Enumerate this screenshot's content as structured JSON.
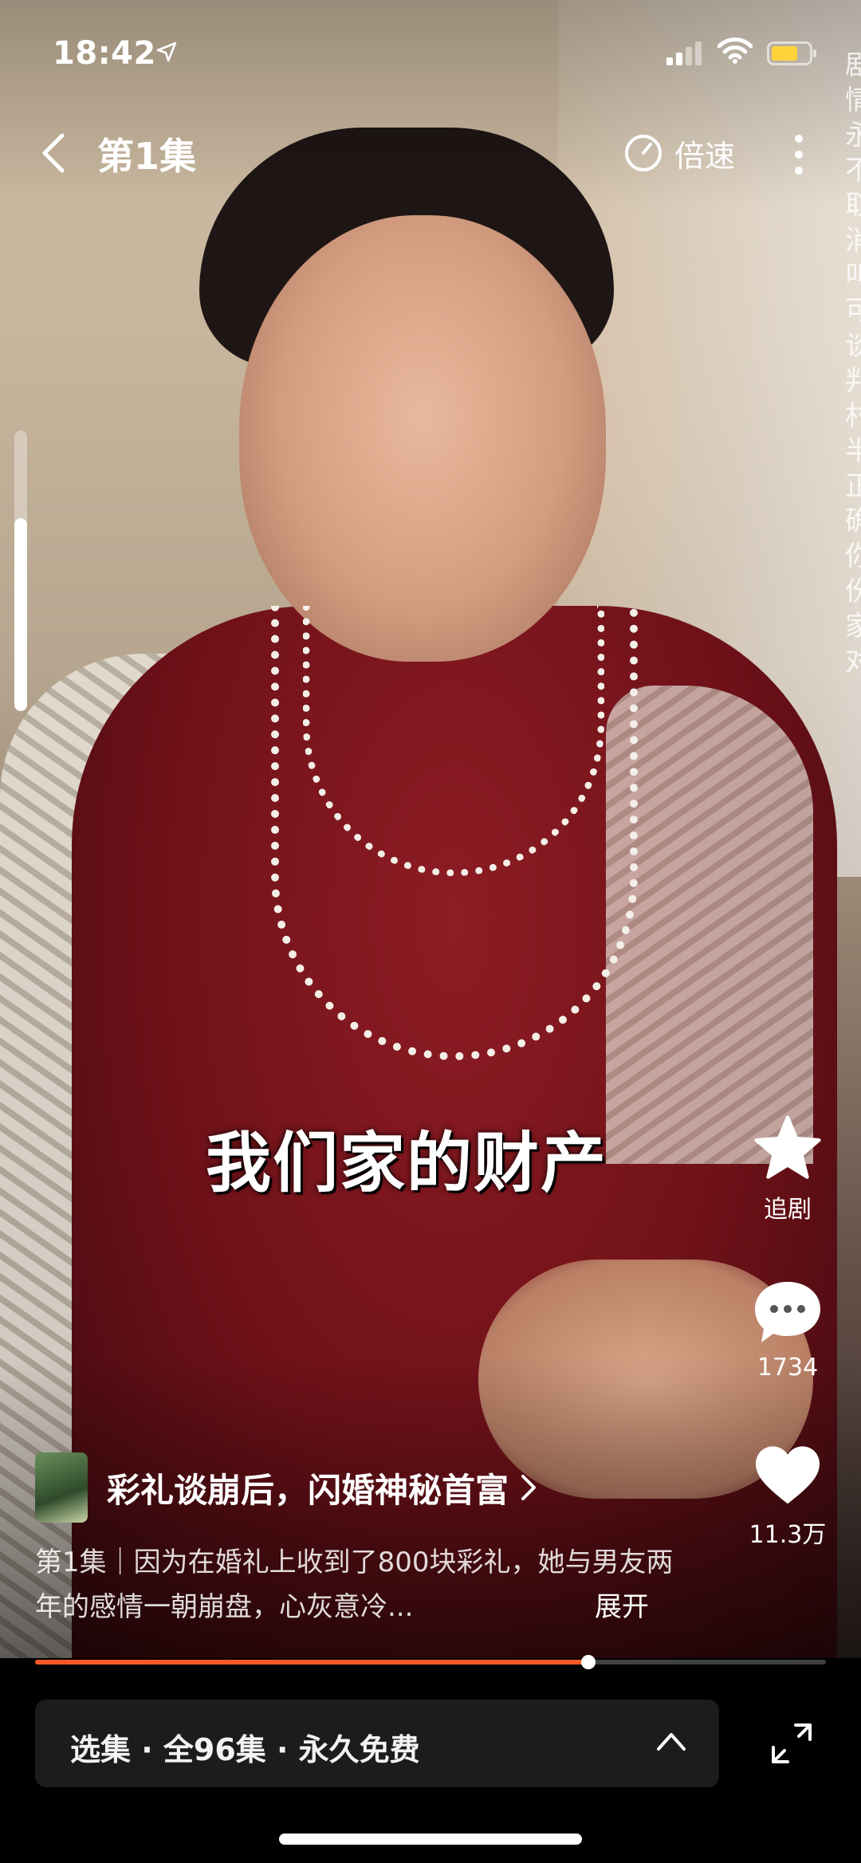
{
  "status_bar": {
    "time": "18:42",
    "icons": [
      "location-arrow-icon",
      "signal-icon",
      "wifi-icon",
      "battery-icon"
    ]
  },
  "nav": {
    "episode_title": "第1集",
    "speed_label": "倍速",
    "icons": [
      "back-icon",
      "speed-icon",
      "more-icon"
    ]
  },
  "edge_text": "剧情永不取消叫可谈判村半正确你份家对",
  "subtitle": "我们家的财产",
  "actions": {
    "follow_label": "追剧",
    "comment_count": "1734",
    "like_count": "11.3万"
  },
  "drama": {
    "title": "彩礼谈崩后，闪婚神秘首富",
    "description": "第1集｜因为在婚礼上收到了800块彩礼，她与男友两年的感情一朝崩盘，心灰意冷...",
    "expand_label": "展开"
  },
  "playback": {
    "progress": 0.7
  },
  "bottom": {
    "episode_selector_label": "选集 · 全96集 · 永久免费"
  },
  "colors": {
    "accent": "#ff5a26",
    "selector_bg": "#1c1c1e",
    "battery": "#ffd23c"
  }
}
